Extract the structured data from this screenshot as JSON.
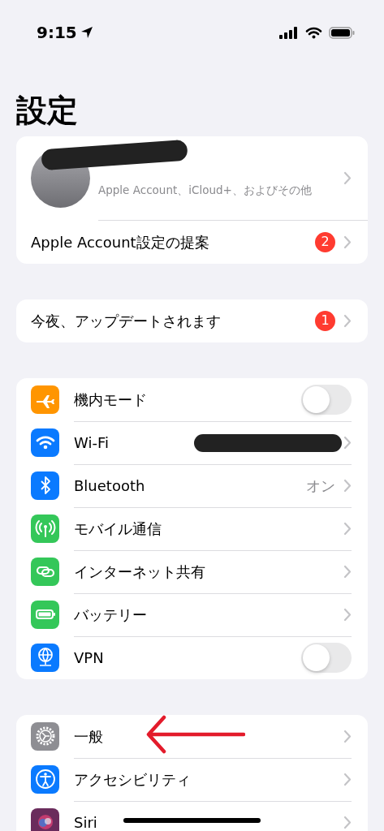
{
  "status_bar": {
    "time": "9:15",
    "location_active": true
  },
  "title": "設定",
  "account": {
    "subtitle": "Apple Account、iCloud+、およびその他",
    "name_redacted": true
  },
  "groups": [
    [
      {
        "kind": "link",
        "label": "Apple Account設定の提案",
        "badge": "2"
      }
    ],
    [
      {
        "kind": "link",
        "label": "今夜、アップデートされます",
        "badge": "1"
      }
    ],
    [
      {
        "kind": "toggle",
        "color": "#ff9500",
        "label": "機内モード",
        "on": false
      },
      {
        "kind": "link",
        "color": "#0a7aff",
        "label": "Wi-Fi",
        "value_redacted": true
      },
      {
        "kind": "link",
        "color": "#0a7aff",
        "label": "Bluetooth",
        "value": "オン"
      },
      {
        "kind": "link",
        "color": "#34c759",
        "label": "モバイル通信"
      },
      {
        "kind": "link",
        "color": "#34c759",
        "label": "インターネット共有"
      },
      {
        "kind": "link",
        "color": "#34c759",
        "label": "バッテリー"
      },
      {
        "kind": "toggle",
        "color": "#0a7aff",
        "label": "VPN",
        "on": false
      }
    ],
    [
      {
        "kind": "link",
        "color": "#8e8e93",
        "label": "一般",
        "pointed_at": true
      },
      {
        "kind": "link",
        "color": "#0a7aff",
        "label": "アクセシビリティ"
      },
      {
        "kind": "link",
        "color": "#6a2c5c",
        "label": "Siri"
      }
    ]
  ]
}
